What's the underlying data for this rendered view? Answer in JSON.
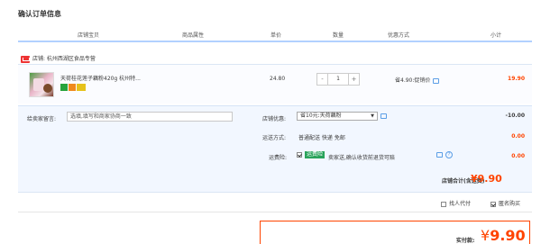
{
  "page": {
    "title": "确认订单信息"
  },
  "header": {
    "col_item": "店铺宝贝",
    "col_attr": "商品属性",
    "col_price": "单价",
    "col_qty": "数量",
    "col_promo": "优惠方式",
    "col_subtotal": "小计"
  },
  "shop": {
    "name": "店铺: 杭州西湖区食品专营"
  },
  "item": {
    "name": "天荷桂花莲子藕粉420g 杭州特...",
    "price": "24.80",
    "qty": "1",
    "qty_minus": "-",
    "qty_plus": "+",
    "promo": "省4.90:促销价",
    "subtotal": "19.90"
  },
  "message": {
    "label": "给卖家留言:",
    "value": "选填,填写和商家协商一致"
  },
  "coupon": {
    "label": "店铺优惠:",
    "selected": "省10元:天荷藕粉",
    "caret": "▼",
    "amount": "-10.00"
  },
  "shipping": {
    "label": "运送方式:",
    "value": "普通配送 快递 免邮",
    "amount": "0.00"
  },
  "insurance": {
    "label": "运费险:",
    "tag": "运费险",
    "text": "卖家送,确认收货前退货可赔",
    "help": "?",
    "amount": "0.00"
  },
  "shop_total": {
    "label": "店铺合计(含运费)",
    "value": "¥9.90"
  },
  "options": {
    "proxy_pay": "找人代付",
    "anonymous": "匿名购买"
  },
  "payment": {
    "label": "实付款:",
    "currency": "¥",
    "value": "9.90"
  },
  "colors": {
    "accent": "#ff4400",
    "header_line": "#b2d1ff",
    "section_bg": "#f2f7ff"
  }
}
